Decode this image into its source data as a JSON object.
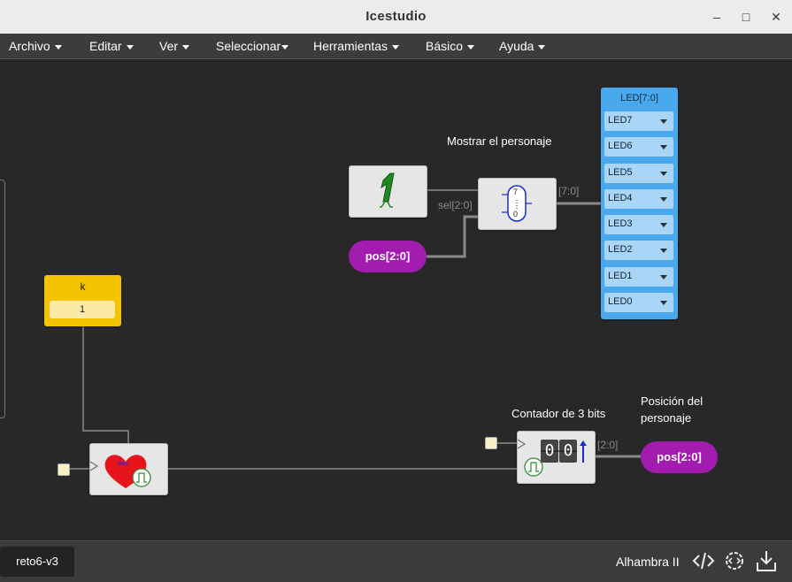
{
  "window": {
    "title": "Icestudio",
    "minimize": "–",
    "maximize": "□",
    "close": "✕"
  },
  "menu": [
    {
      "label": "Archivo"
    },
    {
      "label": "Editar"
    },
    {
      "label": "Ver"
    },
    {
      "label": "Seleccionar"
    },
    {
      "label": "Herramientas"
    },
    {
      "label": "Básico"
    },
    {
      "label": "Ayuda"
    }
  ],
  "canvas": {
    "comments": {
      "mostrar": "Mostrar el personaje",
      "contador": "Contador de 3 bits",
      "posicion_line1": "Posición del",
      "posicion_line2": "personaje"
    },
    "constant": {
      "name": "k",
      "value": "1"
    },
    "wire_labels": {
      "sel": "sel[2:0]",
      "bus_out": "[7:0]",
      "counter_out": "[2:0]"
    },
    "pos_input_label": "pos[2:0]",
    "pos_output_label": "pos[2:0]",
    "mux_top": "7",
    "mux_bottom": "0",
    "counter_digits": [
      "0",
      "0"
    ],
    "heart_label": "Sec",
    "led_block": {
      "title": "LED[7:0]",
      "items": [
        "LED7",
        "LED6",
        "LED5",
        "LED4",
        "LED3",
        "LED2",
        "LED1",
        "LED0"
      ]
    }
  },
  "statusbar": {
    "tab": "reto6-v3",
    "board": "Alhambra II"
  },
  "icons": {
    "code": "code-icon",
    "settings": "gear-code-icon",
    "upload": "download-tray-icon"
  },
  "colors": {
    "pill": "#a21caf",
    "led_block": "#4aa9ec",
    "constant": "#f5c400"
  }
}
